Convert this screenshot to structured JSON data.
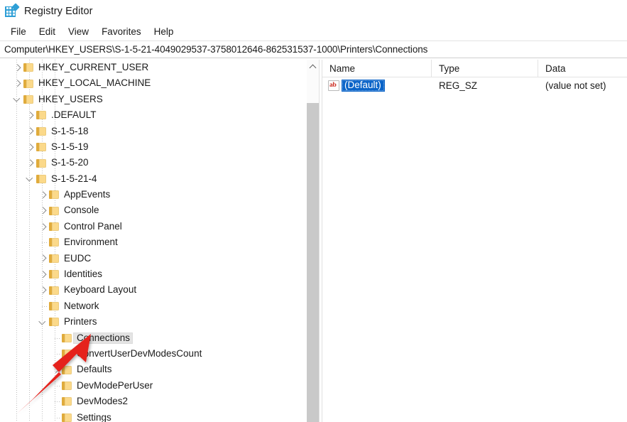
{
  "window": {
    "title": "Registry Editor",
    "icon": "registry-editor-icon"
  },
  "menubar": {
    "items": [
      {
        "label": "File"
      },
      {
        "label": "Edit"
      },
      {
        "label": "View"
      },
      {
        "label": "Favorites"
      },
      {
        "label": "Help"
      }
    ]
  },
  "address": {
    "path": "Computer\\HKEY_USERS\\S-1-5-21-4049029537-3758012646-862531537-1000\\Printers\\Connections"
  },
  "tree": {
    "nodes": [
      {
        "label": "HKEY_CURRENT_USER",
        "depth": 1,
        "state": "collapsed",
        "selected": false
      },
      {
        "label": "HKEY_LOCAL_MACHINE",
        "depth": 1,
        "state": "collapsed",
        "selected": false
      },
      {
        "label": "HKEY_USERS",
        "depth": 1,
        "state": "expanded",
        "selected": false
      },
      {
        "label": ".DEFAULT",
        "depth": 2,
        "state": "collapsed",
        "selected": false
      },
      {
        "label": "S-1-5-18",
        "depth": 2,
        "state": "collapsed",
        "selected": false
      },
      {
        "label": "S-1-5-19",
        "depth": 2,
        "state": "collapsed",
        "selected": false
      },
      {
        "label": "S-1-5-20",
        "depth": 2,
        "state": "collapsed",
        "selected": false
      },
      {
        "label": "S-1-5-21-4",
        "depth": 2,
        "state": "expanded",
        "selected": false
      },
      {
        "label": "AppEvents",
        "depth": 3,
        "state": "collapsed",
        "selected": false
      },
      {
        "label": "Console",
        "depth": 3,
        "state": "collapsed",
        "selected": false
      },
      {
        "label": "Control Panel",
        "depth": 3,
        "state": "collapsed",
        "selected": false
      },
      {
        "label": "Environment",
        "depth": 3,
        "state": "leaf",
        "selected": false
      },
      {
        "label": "EUDC",
        "depth": 3,
        "state": "collapsed",
        "selected": false
      },
      {
        "label": "Identities",
        "depth": 3,
        "state": "collapsed",
        "selected": false
      },
      {
        "label": "Keyboard Layout",
        "depth": 3,
        "state": "collapsed",
        "selected": false
      },
      {
        "label": "Network",
        "depth": 3,
        "state": "leaf",
        "selected": false
      },
      {
        "label": "Printers",
        "depth": 3,
        "state": "expanded",
        "selected": false
      },
      {
        "label": "Connections",
        "depth": 4,
        "state": "leaf",
        "selected": true
      },
      {
        "label": "ConvertUserDevModesCount",
        "depth": 4,
        "state": "leaf",
        "selected": false
      },
      {
        "label": "Defaults",
        "depth": 4,
        "state": "collapsed",
        "selected": false
      },
      {
        "label": "DevModePerUser",
        "depth": 4,
        "state": "leaf",
        "selected": false
      },
      {
        "label": "DevModes2",
        "depth": 4,
        "state": "leaf",
        "selected": false
      },
      {
        "label": "Settings",
        "depth": 4,
        "state": "leaf",
        "selected": false
      }
    ]
  },
  "values": {
    "columns": [
      "Name",
      "Type",
      "Data"
    ],
    "rows": [
      {
        "name": "(Default)",
        "type": "REG_SZ",
        "data": "(value not set)",
        "icon": "string-value-icon",
        "icon_text": "ab",
        "selected": true
      }
    ]
  },
  "annotation": {
    "arrow_color": "#e5231f",
    "points_to": "Connections"
  }
}
